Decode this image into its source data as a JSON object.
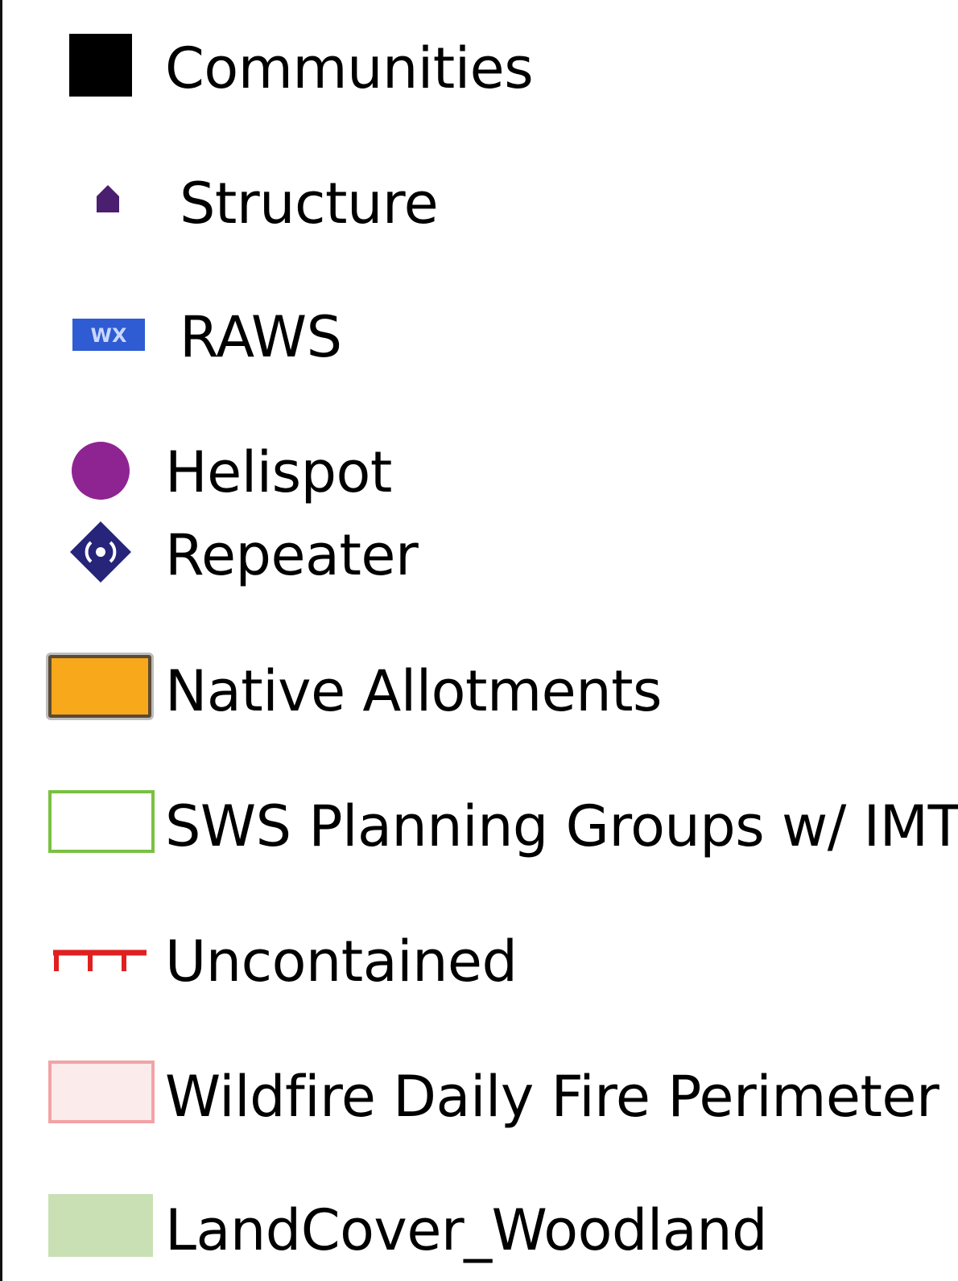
{
  "legend": {
    "items": [
      {
        "id": "communities",
        "label": "Communities",
        "icon": "filled-black-square",
        "color": "#000000"
      },
      {
        "id": "structure",
        "label": "Structure",
        "icon": "house-icon",
        "color": "#4b1f6f"
      },
      {
        "id": "raws",
        "label": "RAWS",
        "icon": "raws-station-icon",
        "color": "#2f5bd3"
      },
      {
        "id": "helispot",
        "label": "Helispot",
        "icon": "purple-circle-icon",
        "color": "#8e2491"
      },
      {
        "id": "repeater",
        "label": "Repeater",
        "icon": "radio-repeater-diamond-icon",
        "color": "#26257a"
      },
      {
        "id": "native-allotments",
        "label": "Native Allotments",
        "icon": "orange-polygon",
        "fill": "#f7a81b",
        "stroke": "#5c4a33"
      },
      {
        "id": "sws-planning-groups",
        "label": "SWS Planning Groups w/ IMT",
        "icon": "green-outline-polygon",
        "fill": "#ffffff",
        "stroke": "#7ac142"
      },
      {
        "id": "uncontained",
        "label": "Uncontained",
        "icon": "red-hachured-line",
        "color": "#e02020"
      },
      {
        "id": "wildfire-daily-fire-perimeter",
        "label": "Wildfire Daily Fire Perimeter",
        "icon": "pink-polygon",
        "fill": "#fcebeb",
        "stroke": "#f2a3a6"
      },
      {
        "id": "landcover-woodland",
        "label": "LandCover_Woodland",
        "icon": "green-fill-polygon",
        "fill": "#c8e0b4"
      }
    ]
  }
}
